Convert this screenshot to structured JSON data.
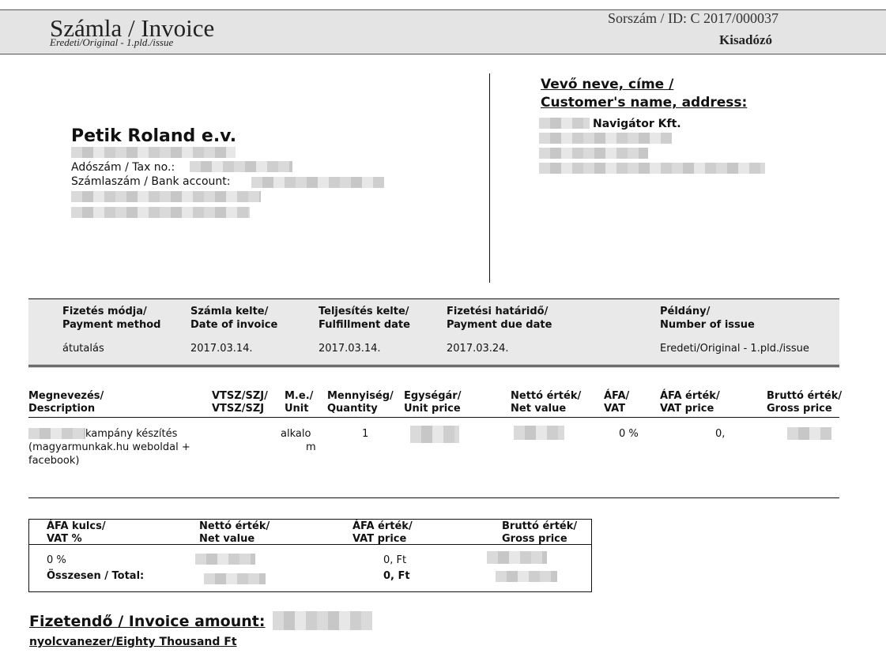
{
  "header": {
    "title": "Számla / Invoice",
    "subtitle": "Eredeti/Original - 1.pld./issue",
    "invoice_id": "Sorszám / ID: C 2017/000037",
    "tax_status": "Kisadózó"
  },
  "seller": {
    "name": "Petik Roland e.v.",
    "tax_label": "Adószám / Tax no.:",
    "bank_label": "Számlaszám / Bank account:"
  },
  "customer": {
    "heading_line1": "Vevő neve, címe /",
    "heading_line2": "Customer's name, address:",
    "name": "Navigátor Kft."
  },
  "meta": {
    "payment_method_label": [
      "Fizetés módja/",
      "Payment method"
    ],
    "invoice_date_label": [
      "Számla kelte/",
      "Date of invoice"
    ],
    "fulfillment_date_label": [
      "Teljesítés kelte/",
      "Fulfillment date"
    ],
    "due_date_label": [
      "Fizetési határidő/",
      "Payment due date"
    ],
    "issue_label": [
      "Példány/",
      "Number of issue"
    ],
    "payment_method": "átutalás",
    "invoice_date": "2017.03.14.",
    "fulfillment_date": "2017.03.14.",
    "due_date": "2017.03.24.",
    "issue": "Eredeti/Original - 1.pld./issue"
  },
  "items_table": {
    "headers": [
      [
        "Megnevezés/",
        "Description"
      ],
      [
        "VTSZ/SZJ/",
        "VTSZ/SZJ"
      ],
      [
        "M.e./",
        "Unit"
      ],
      [
        "Mennyiség/",
        "Quantity"
      ],
      [
        "Egységár/",
        "Unit price"
      ],
      [
        "Nettó érték/",
        "Net value"
      ],
      [
        "ÁFA/",
        "VAT"
      ],
      [
        "ÁFA érték/",
        "VAT price"
      ],
      [
        "Bruttó érték/",
        "Gross price"
      ]
    ],
    "rows": [
      {
        "description_line1": "kampány készítés",
        "description_line2": "(magyarmunkak.hu weboldal +",
        "description_line3": "facebook)",
        "unit_line1": "alkalo",
        "unit_line2": "m",
        "quantity": "1",
        "vat": "0 %",
        "vat_price": "0,"
      }
    ]
  },
  "vat_summary": {
    "headers": [
      [
        "ÁFA kulcs/",
        "VAT %"
      ],
      [
        "Nettó érték/",
        "Net value"
      ],
      [
        "ÁFA érték/",
        "VAT price"
      ],
      [
        "Bruttó érték/",
        "Gross price"
      ]
    ],
    "rate_row": {
      "rate": "0 %",
      "vat_price": "0, Ft"
    },
    "total_row": {
      "label": "Összesen / Total:",
      "vat_price": "0, Ft"
    }
  },
  "amount": {
    "label": "Fizetendő / Invoice amount:",
    "words": "nyolcvanezer/Eighty  Thousand  Ft"
  }
}
